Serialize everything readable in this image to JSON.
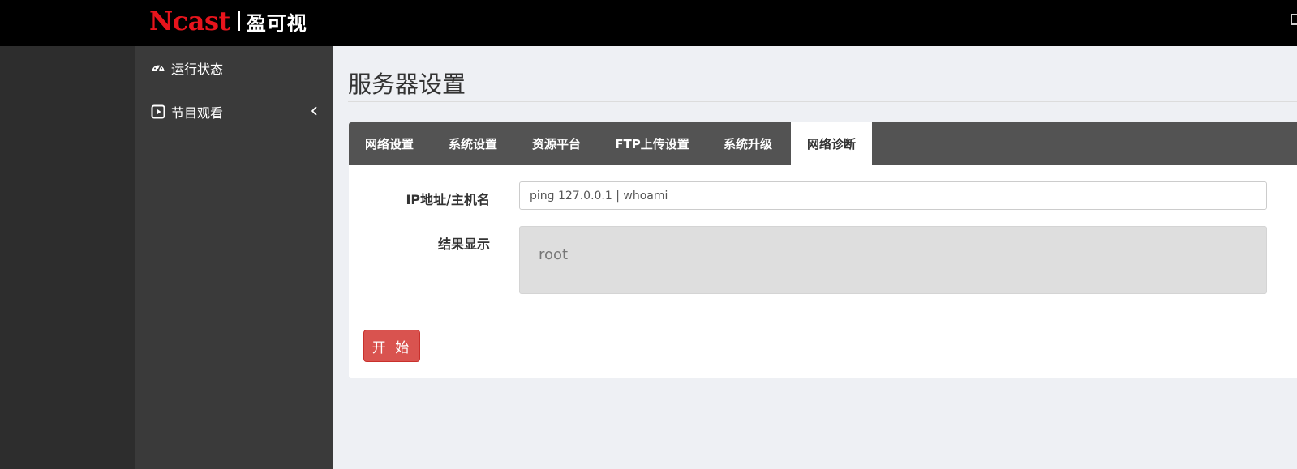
{
  "header": {
    "logo_brand": "Ncast",
    "logo_cn": "盈可视"
  },
  "sidebar": {
    "items": [
      {
        "label": "运行状态",
        "icon": "dashboard-icon"
      },
      {
        "label": "节目观看",
        "icon": "play-square-icon",
        "has_submenu": true
      }
    ]
  },
  "main": {
    "page_title": "服务器设置",
    "tabs": [
      {
        "label": "网络设置"
      },
      {
        "label": "系统设置"
      },
      {
        "label": "资源平台"
      },
      {
        "label": "FTP上传设置"
      },
      {
        "label": "系统升级"
      },
      {
        "label": "网络诊断",
        "active": true
      }
    ],
    "form": {
      "ip_label": "IP地址/主机名",
      "ip_value": "ping 127.0.0.1 | whoami",
      "result_label": "结果显示",
      "result_text": "root",
      "start_button": "开 始"
    }
  },
  "colors": {
    "topbar": "#000000",
    "logo_red": "#e8141c",
    "sidebar": "#3a3a3a",
    "tabbar": "#535353",
    "active_tab_accent": "#f07b7b",
    "button": "#d9534f"
  }
}
